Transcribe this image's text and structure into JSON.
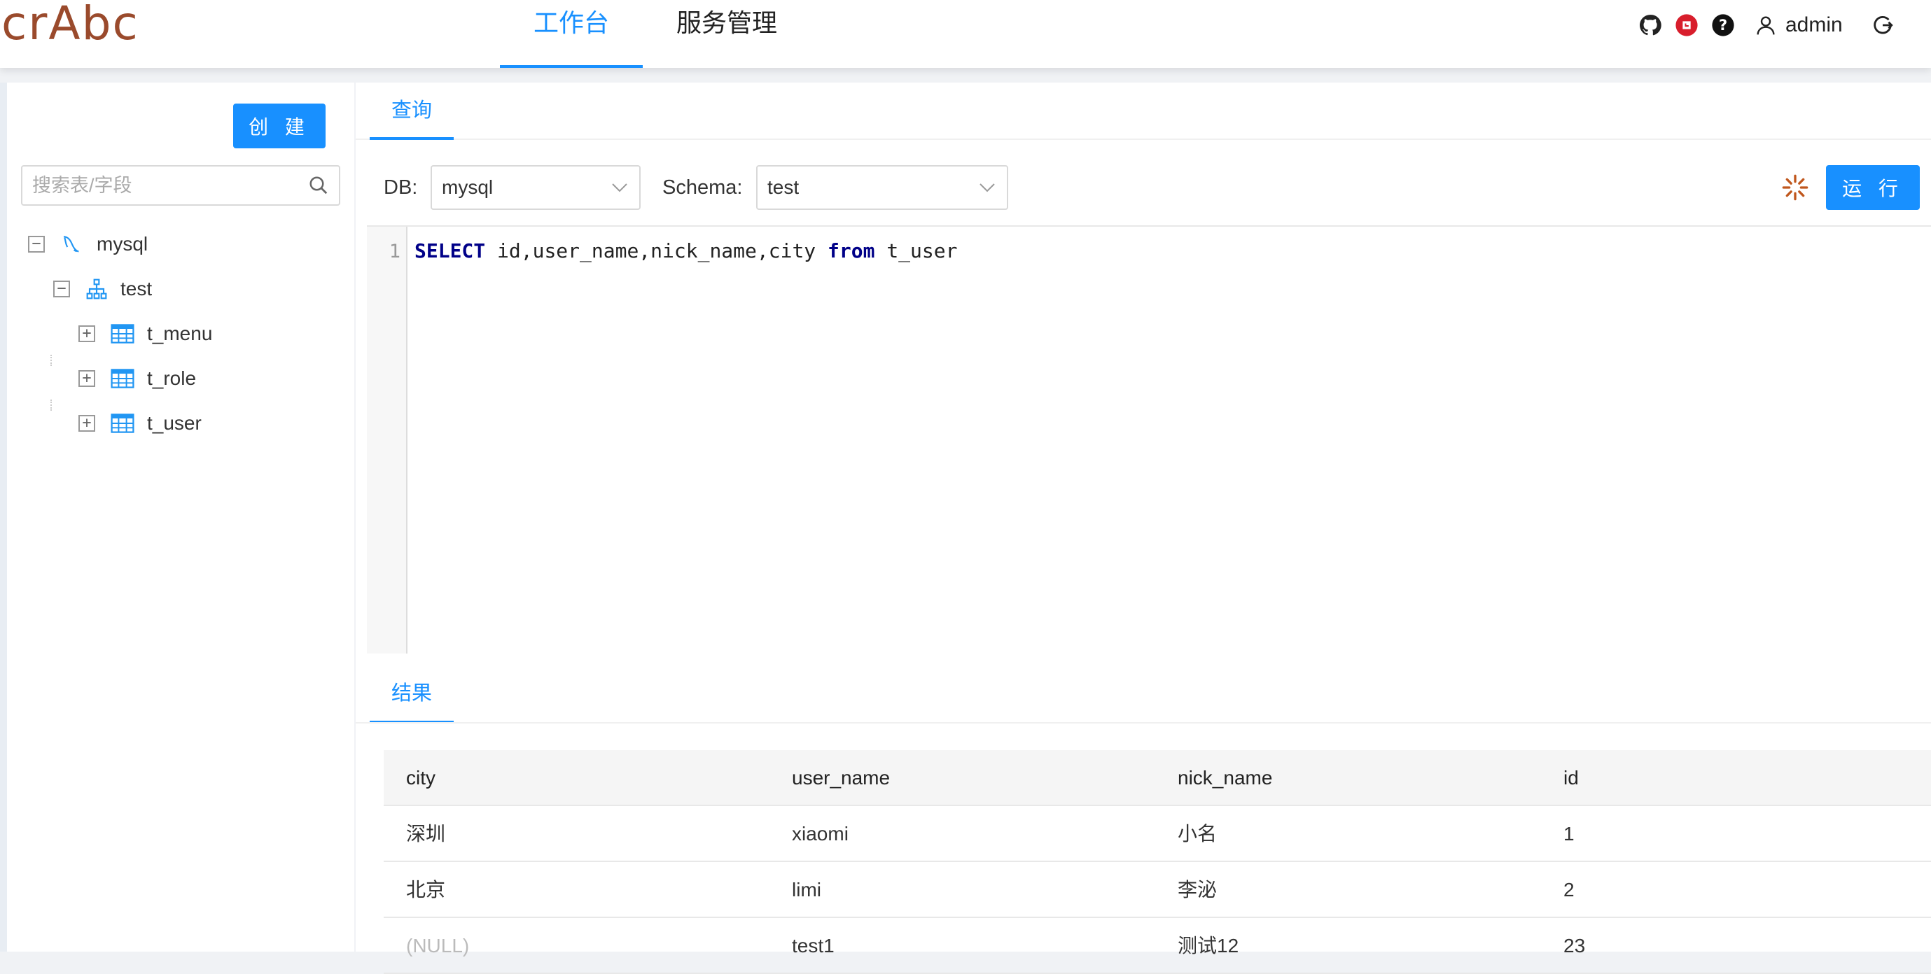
{
  "header": {
    "logo": "crAbc",
    "nav": [
      {
        "label": "工作台",
        "active": true
      },
      {
        "label": "服务管理",
        "active": false
      }
    ],
    "user": "admin",
    "colors": {
      "accent": "#1890ff",
      "logo": "#9a4a2c",
      "gitee": "#d81e2c"
    }
  },
  "sidebar": {
    "create_label": "创 建",
    "search_placeholder": "搜索表/字段",
    "tree": {
      "db": "mysql",
      "schema": "test",
      "tables": [
        "t_menu",
        "t_role",
        "t_user"
      ]
    }
  },
  "main": {
    "tab_label": "查询",
    "db_label": "DB:",
    "db_value": "mysql",
    "schema_label": "Schema:",
    "schema_value": "test",
    "run_label": "运 行",
    "editor": {
      "line_number": "1",
      "kw_select": "SELECT",
      "cols": " id,user_name,nick_name,city ",
      "kw_from": "from",
      "table": " t_user"
    },
    "results_tab": "结果",
    "results": {
      "columns": [
        "city",
        "user_name",
        "nick_name",
        "id"
      ],
      "rows": [
        [
          "深圳",
          "xiaomi",
          "小名",
          "1"
        ],
        [
          "北京",
          "limi",
          "李泌",
          "2"
        ],
        [
          "(NULL)",
          "test1",
          "测试12",
          "23"
        ]
      ]
    }
  }
}
